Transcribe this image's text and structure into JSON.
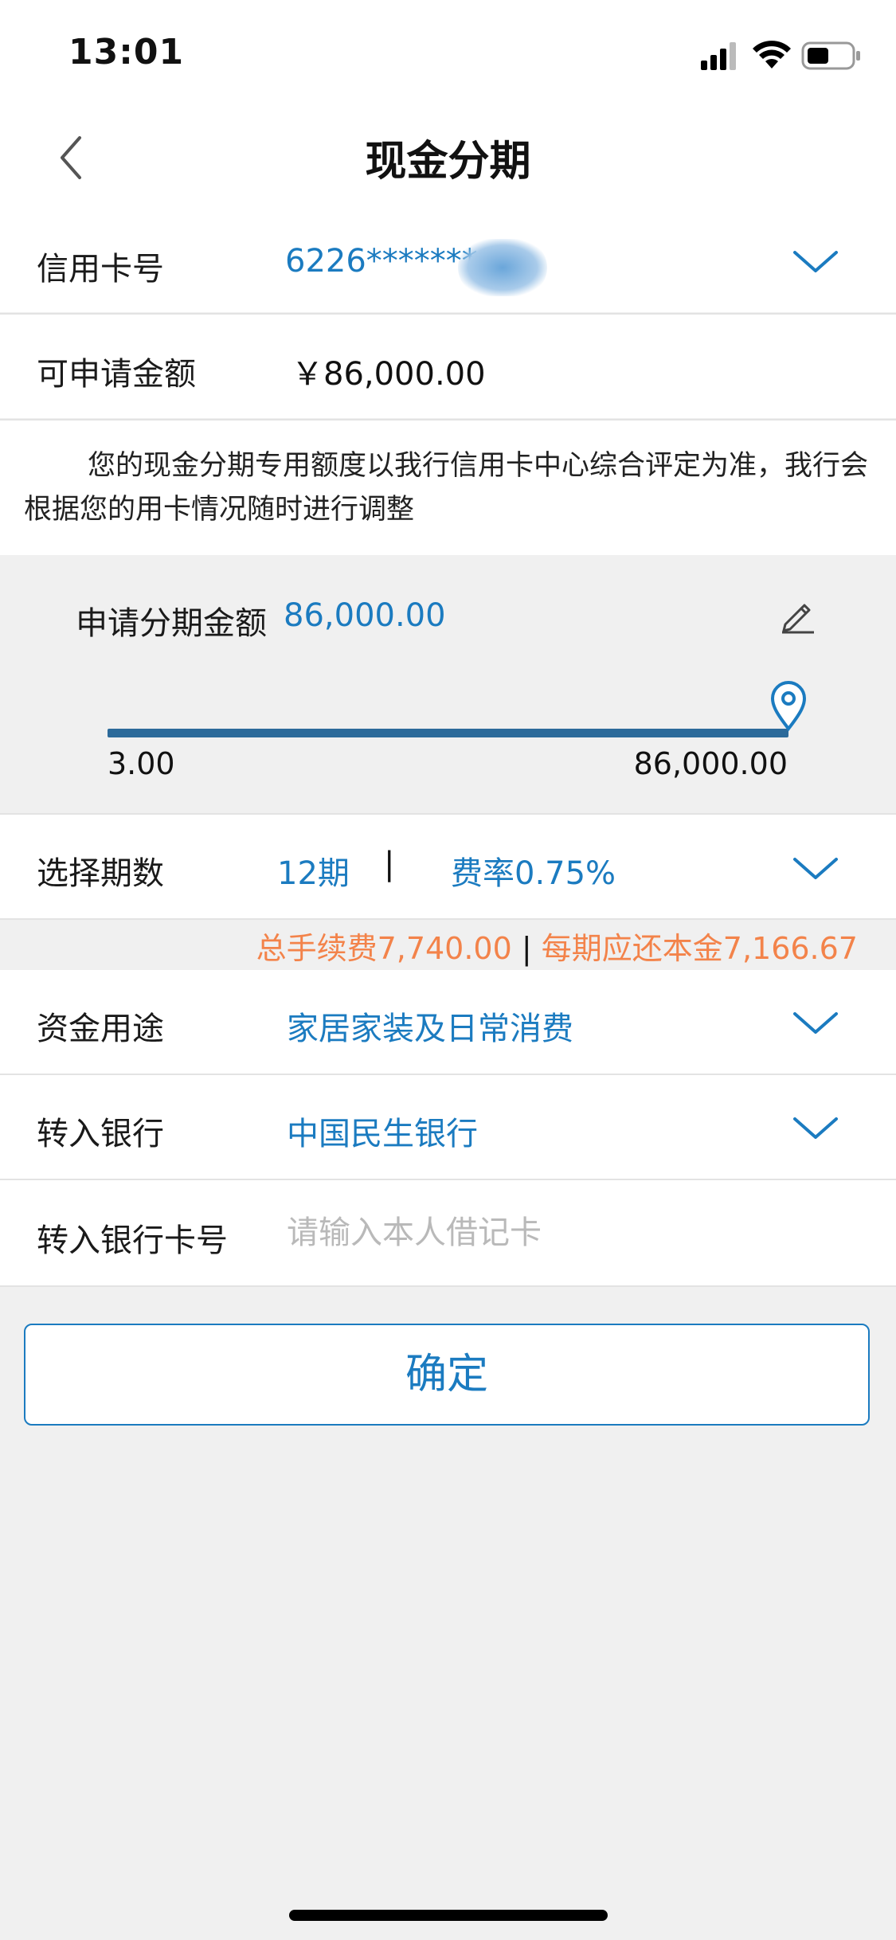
{
  "status_bar": {
    "time": "13:01"
  },
  "nav": {
    "title": "现金分期"
  },
  "card_row": {
    "label": "信用卡号",
    "value": "6226********"
  },
  "limit_row": {
    "label": "可申请金额",
    "value": "￥86,000.00"
  },
  "notice": "您的现金分期专用额度以我行信用卡中心综合评定为准，我行会根据您的用卡情况随时进行调整",
  "amount": {
    "label": "申请分期金额",
    "value": "86,000.00",
    "slider_min": "3.00",
    "slider_max": "86,000.00",
    "slider_level": 1.0
  },
  "period_row": {
    "label": "选择期数",
    "period": "12期",
    "separator": "|",
    "rate": "费率0.75%"
  },
  "fee_summary": {
    "total_fee": "总手续费7,740.00",
    "separator": " | ",
    "per_period": "每期应还本金7,166.67"
  },
  "purpose_row": {
    "label": "资金用途",
    "value": "家居家装及日常消费"
  },
  "bank_row": {
    "label": "转入银行",
    "value": "中国民生银行"
  },
  "card_no_row": {
    "label": "转入银行卡号",
    "placeholder": "请输入本人借记卡"
  },
  "confirm_button": {
    "label": "确定"
  },
  "colors": {
    "accent": "#1b7bc0",
    "fee": "#f3834a",
    "track": "#2c6a9a"
  },
  "icons": [
    "signal-icon",
    "wifi-icon",
    "battery-icon",
    "back-arrow-icon",
    "chevron-down-icon",
    "edit-icon",
    "location-pin-icon"
  ]
}
